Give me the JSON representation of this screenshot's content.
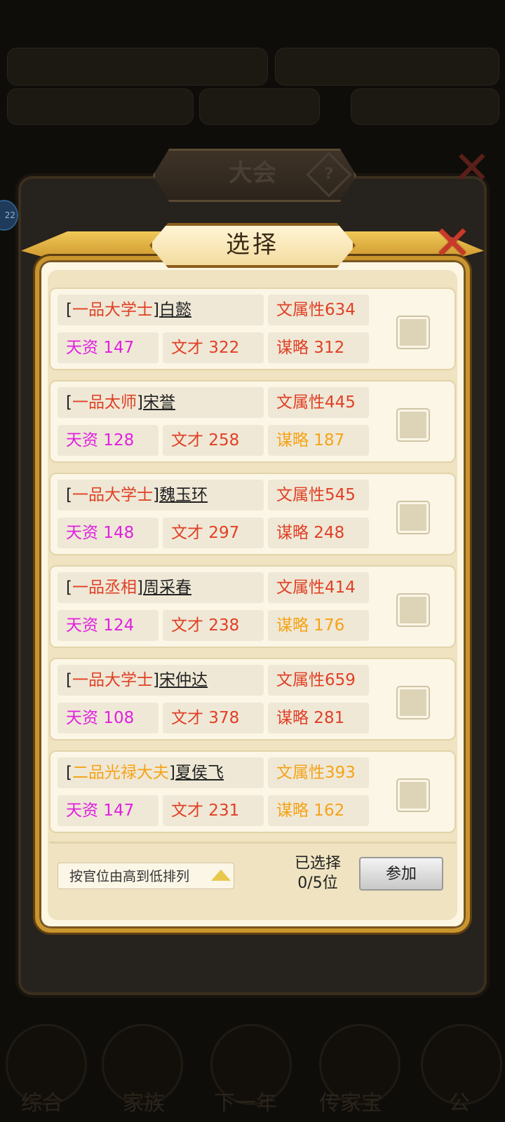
{
  "outer_dialog": {
    "title": "大会",
    "help": "?",
    "close": "✕",
    "side_badge": "22"
  },
  "dialog": {
    "title": "选择",
    "close": "✕"
  },
  "candidates": [
    {
      "rank": "一品大学士",
      "name": "白懿",
      "attr": "文属性634",
      "talent": "天资 147",
      "lit": "文才 322",
      "strat": "谋略 312",
      "attr_color": "red",
      "strat_color": "red",
      "rank_color": "red"
    },
    {
      "rank": "一品太师",
      "name": "宋誉",
      "attr": "文属性445",
      "talent": "天资 128",
      "lit": "文才 258",
      "strat": "谋略 187",
      "attr_color": "red",
      "strat_color": "orange",
      "rank_color": "red"
    },
    {
      "rank": "一品大学士",
      "name": "魏玉环",
      "attr": "文属性545",
      "talent": "天资 148",
      "lit": "文才 297",
      "strat": "谋略 248",
      "attr_color": "red",
      "strat_color": "red",
      "rank_color": "red"
    },
    {
      "rank": "一品丞相",
      "name": "周采春",
      "attr": "文属性414",
      "talent": "天资 124",
      "lit": "文才 238",
      "strat": "谋略 176",
      "attr_color": "red",
      "strat_color": "orange",
      "rank_color": "red"
    },
    {
      "rank": "一品大学士",
      "name": "宋仲达",
      "attr": "文属性659",
      "talent": "天资 108",
      "lit": "文才 378",
      "strat": "谋略 281",
      "attr_color": "red",
      "strat_color": "red",
      "rank_color": "red"
    },
    {
      "rank": "二品光禄大夫",
      "name": "夏侯飞",
      "attr": "文属性393",
      "talent": "天资 147",
      "lit": "文才 231",
      "strat": "谋略 162",
      "attr_color": "orange",
      "strat_color": "orange",
      "rank_color": "orange"
    }
  ],
  "footer": {
    "sort_label": "按官位由高到低排列",
    "selected_label": "已选择",
    "selected_count": "0/5位",
    "join_label": "参加"
  },
  "background": {
    "bottom_nav": [
      "综合",
      "家族",
      "下一年",
      "传家宝",
      "公"
    ]
  },
  "colors": {
    "red": "#e04026",
    "orange": "#f5a318",
    "magenta": "#e020e0",
    "gold": "#c9952d"
  }
}
